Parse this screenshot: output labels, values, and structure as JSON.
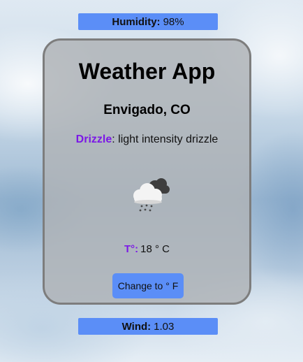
{
  "humidity": {
    "label": "Humidity:",
    "value": "98%"
  },
  "card": {
    "title": "Weather App",
    "city": "Envigado, CO",
    "condition": {
      "main": "Drizzle",
      "separator": ":",
      "description": " light intensity drizzle"
    },
    "icon": "drizzle-cloud-icon",
    "temperature": {
      "label": "T°:",
      "value": "18 ° C"
    },
    "unit_button_label": "Change to ° F"
  },
  "wind": {
    "label": "Wind:",
    "value": "1.03"
  },
  "colors": {
    "accent_blue": "#5b8ef7",
    "highlight_purple": "#7b18e6",
    "card_border": "#7d7d7d"
  }
}
